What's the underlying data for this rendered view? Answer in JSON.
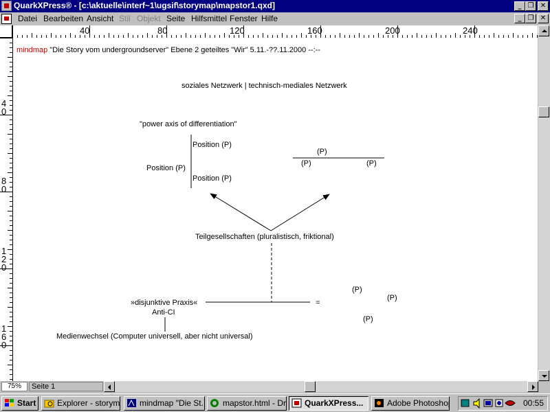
{
  "window": {
    "title": "QuarkXPress® - [c:\\aktuelle\\interf~1\\ugsif\\storymap\\mapstor1.qxd]"
  },
  "menu": {
    "items": [
      {
        "label": "Datei",
        "enabled": true
      },
      {
        "label": "Bearbeiten",
        "enabled": true
      },
      {
        "label": "Ansicht",
        "enabled": true
      },
      {
        "label": "Stil",
        "enabled": false
      },
      {
        "label": "Objekt",
        "enabled": false
      },
      {
        "label": "Seite",
        "enabled": true
      },
      {
        "label": "Hilfsmittel",
        "enabled": true
      },
      {
        "label": "Fenster",
        "enabled": true
      },
      {
        "label": "Hilfe",
        "enabled": true
      }
    ]
  },
  "rulers": {
    "horizontal": [
      "40",
      "80",
      "120",
      "160",
      "200",
      "240"
    ],
    "vertical": [
      "40",
      "80",
      "120",
      "160"
    ]
  },
  "document": {
    "header_keyword": "mindmap",
    "header_rest": " \"Die Story vom undergroundserver\" Ebene 2  geteiltes \"Wir\" 5.11.-??.11.2000 --:--",
    "subtitle": "soziales Netzwerk | technisch-mediales Netzwerk",
    "power_axis": "\"power axis of differentiation\"",
    "position_left": "Position (P)",
    "position_top": "Position (P)",
    "position_bottom": "Position (P)",
    "p_label": "(P)",
    "teilgesellschaften": "Teilgesellschaften (pluralistisch, friktional)",
    "disjunktive": "»disjunktive Praxis«",
    "equals": "=",
    "anti_ci": "Anti-CI",
    "medienwechsel": "Medienwechsel (Computer universell, aber nicht universal)",
    "header_color": "#cc0000"
  },
  "statusbar": {
    "zoom": "75%",
    "page": "Seite 1"
  },
  "taskbar": {
    "start": "Start",
    "buttons": [
      {
        "label": "Explorer - storymap",
        "active": false
      },
      {
        "label": "mindmap \"Die St...",
        "active": false
      },
      {
        "label": "mapstor.html - Dr...",
        "active": false
      },
      {
        "label": "QuarkXPress...",
        "active": true
      },
      {
        "label": "Adobe Photoshop",
        "active": false
      }
    ],
    "clock": "00:55"
  },
  "colors": {
    "titlebar": "#000080",
    "chrome": "#c0c0c0"
  }
}
